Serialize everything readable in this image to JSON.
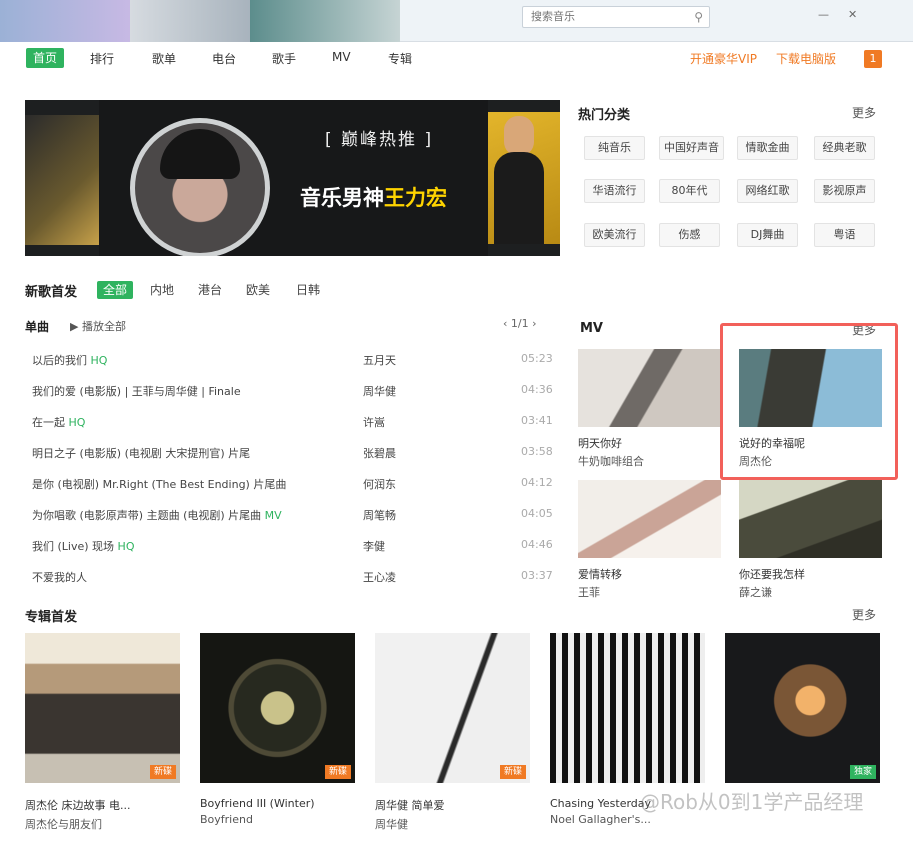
{
  "search": {
    "placeholder": "搜索音乐"
  },
  "nav": {
    "home": "首页",
    "items": [
      "排行",
      "歌单",
      "电台",
      "歌手",
      "MV",
      "专辑"
    ],
    "right_links": [
      "开通豪华VIP",
      "下载电脑版"
    ],
    "badge": "1"
  },
  "banner": {
    "kicker": "[ 巅峰热推 ]",
    "headline_prefix": "音乐男神",
    "headline_highlight": "王力宏"
  },
  "hot_categories": {
    "title": "热门分类",
    "more": "更多",
    "tags": [
      "纯音乐",
      "中国好声音",
      "情歌金曲",
      "经典老歌",
      "华语流行",
      "80年代",
      "网络红歌",
      "影视原声",
      "欧美流行",
      "伤感",
      "DJ舞曲",
      "粤语"
    ]
  },
  "new_songs": {
    "title": "新歌首发",
    "filters": [
      "全部",
      "内地",
      "港台",
      "欧美",
      "日韩"
    ],
    "list_title": "单曲",
    "play_all": "播放全部",
    "pager": "‹  1/1  ›",
    "songs": [
      {
        "name": "以后的我们",
        "hq": "HQ",
        "artist": "五月天",
        "duration": "05:23"
      },
      {
        "name": "我们的爱 (电影版) | 王菲与周华健 | Finale",
        "hq": "",
        "artist": "周华健",
        "duration": "04:36"
      },
      {
        "name": "在一起",
        "hq": "HQ",
        "artist": "许嵩",
        "duration": "03:41"
      },
      {
        "name": "明日之子  (电影版)  (电视剧 大宋提刑官) 片尾",
        "hq": "",
        "artist": "张碧晨",
        "duration": "03:58"
      },
      {
        "name": "是你  (电视剧) Mr.Right  (The Best Ending) 片尾曲",
        "hq": "",
        "artist": "何润东",
        "duration": "04:12"
      },
      {
        "name": "为你唱歌 (电影原声带) 主题曲  (电视剧) 片尾曲",
        "hq": "MV",
        "artist": "周笔畅",
        "duration": "04:05"
      },
      {
        "name": "我们 (Live) 现场",
        "hq": "HQ",
        "artist": "李健",
        "duration": "04:46"
      },
      {
        "name": "不爱我的人",
        "hq": "",
        "artist": "王心凌",
        "duration": "03:37"
      }
    ]
  },
  "mv_section": {
    "title": "MV",
    "more": "更多",
    "items": [
      {
        "title": "明天你好",
        "artist": "牛奶咖啡组合"
      },
      {
        "title": "说好的幸福呢",
        "artist": "周杰伦"
      },
      {
        "title": "爱情转移",
        "artist": "王菲"
      },
      {
        "title": "你还要我怎样",
        "artist": "薛之谦"
      }
    ]
  },
  "albums": {
    "title": "专辑首发",
    "more": "更多",
    "items": [
      {
        "title": "周杰伦 床边故事 电...",
        "artist": "周杰伦与朋友们",
        "tag": "新碟"
      },
      {
        "title": "Boyfriend III (Winter)",
        "artist": "Boyfriend",
        "tag": "新碟"
      },
      {
        "title": "周华健 简单爱",
        "artist": "周华健",
        "tag": "新碟"
      },
      {
        "title": "Chasing Yesterday",
        "artist": "Noel Gallagher's...",
        "tag": ""
      },
      {
        "title": "",
        "artist": "",
        "tag": "独家"
      }
    ]
  },
  "watermark": "@Rob从0到1学产品经理"
}
